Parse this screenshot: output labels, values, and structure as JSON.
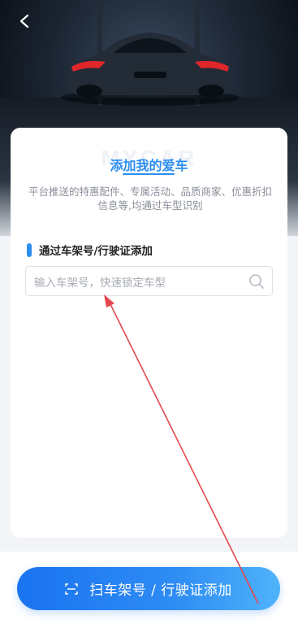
{
  "header": {
    "back_icon": "chevron-left-icon"
  },
  "card": {
    "watermark": "MYCAR",
    "title": "添加我的爱车",
    "description": "平台推送的特惠配件、专属活动、品质商家、优惠折扣信息等,均通过车型识别"
  },
  "section": {
    "label": "通过车架号/行驶证添加"
  },
  "search": {
    "placeholder": "输入车架号，快速锁定车型",
    "icon": "search-icon"
  },
  "bottom": {
    "scan_button_label": "扫车架号 / 行驶证添加",
    "scan_icon": "scan-icon"
  },
  "colors": {
    "accent": "#2b8ef0",
    "annotation_arrow": "#e5484d"
  }
}
